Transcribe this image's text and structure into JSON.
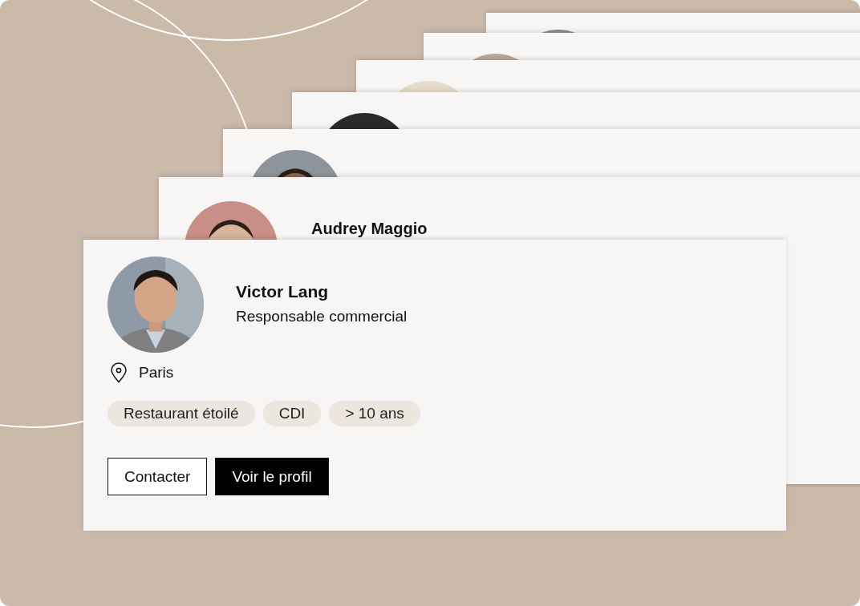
{
  "back_cards": [
    {
      "avatar": {
        "kind": "picture"
      }
    },
    {
      "avatar": {
        "kind": "picture"
      }
    },
    {
      "avatar": {
        "kind": "picture"
      }
    },
    {
      "avatar": {
        "kind": "picture"
      }
    },
    {
      "avatar": {
        "kind": "picture"
      }
    },
    {
      "avatar": {
        "kind": "picture"
      },
      "name": "Audrey Maggio"
    }
  ],
  "profile_card": {
    "avatar": {
      "kind": "picture"
    },
    "name": "Victor Lang",
    "role": "Responsable commercial",
    "location": "Paris",
    "tags": [
      "Restaurant étoilé",
      "CDI",
      "> 10 ans"
    ],
    "buttons": [
      {
        "label": "Contacter",
        "kind": "outline"
      },
      {
        "label": "Voir le profil",
        "kind": "solid"
      }
    ]
  }
}
